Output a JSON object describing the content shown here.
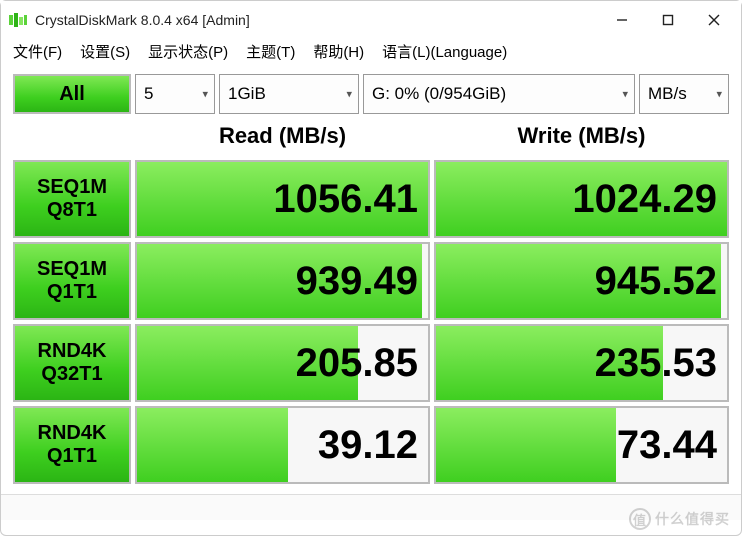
{
  "window": {
    "title": "CrystalDiskMark 8.0.4 x64 [Admin]"
  },
  "menu": {
    "file": "文件(F)",
    "settings": "设置(S)",
    "display": "显示状态(P)",
    "theme": "主题(T)",
    "help": "帮助(H)",
    "language": "语言(L)(Language)"
  },
  "controls": {
    "all_label": "All",
    "runs": "5",
    "size": "1GiB",
    "drive": "G: 0% (0/954GiB)",
    "unit": "MB/s"
  },
  "headers": {
    "read": "Read (MB/s)",
    "write": "Write (MB/s)"
  },
  "tests": [
    {
      "line1": "SEQ1M",
      "line2": "Q8T1",
      "read": "1056.41",
      "write": "1024.29",
      "read_pct": 100,
      "write_pct": 100
    },
    {
      "line1": "SEQ1M",
      "line2": "Q1T1",
      "read": "939.49",
      "write": "945.52",
      "read_pct": 98,
      "write_pct": 98
    },
    {
      "line1": "RND4K",
      "line2": "Q32T1",
      "read": "205.85",
      "write": "235.53",
      "read_pct": 76,
      "write_pct": 78
    },
    {
      "line1": "RND4K",
      "line2": "Q1T1",
      "read": "39.12",
      "write": "73.44",
      "read_pct": 52,
      "write_pct": 62
    }
  ],
  "watermark": {
    "symbol": "值",
    "text": "什么值得买"
  }
}
